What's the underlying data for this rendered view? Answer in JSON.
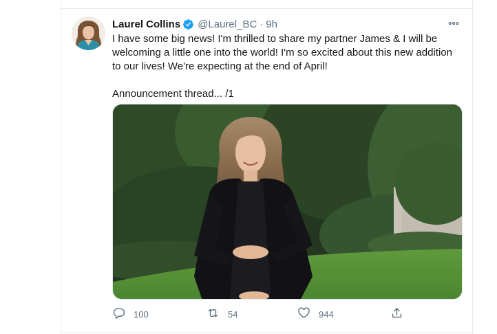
{
  "tweet": {
    "author_name": "Laurel Collins",
    "verified_icon": "verified-badge-icon",
    "handle": "@Laurel_BC",
    "separator": "·",
    "time": "9h",
    "text_line1": "I have some big news! I'm thrilled to share my partner James & I will be welcoming a little one into the world! I'm so excited about this new addition to our lives! We're expecting at the end of April!",
    "text_line2": "Announcement thread... /1",
    "more_icon": "more-options-icon",
    "photo_icon": "photo"
  },
  "actions": {
    "reply_count": "100",
    "retweet_count": "54",
    "like_count": "944",
    "reply_icon": "reply-icon",
    "retweet_icon": "retweet-icon",
    "like_icon": "like-icon",
    "share_icon": "share-icon"
  },
  "colors": {
    "verified": "#1da1f2",
    "secondary_text": "#5b7083",
    "border": "#e6ecf0"
  }
}
